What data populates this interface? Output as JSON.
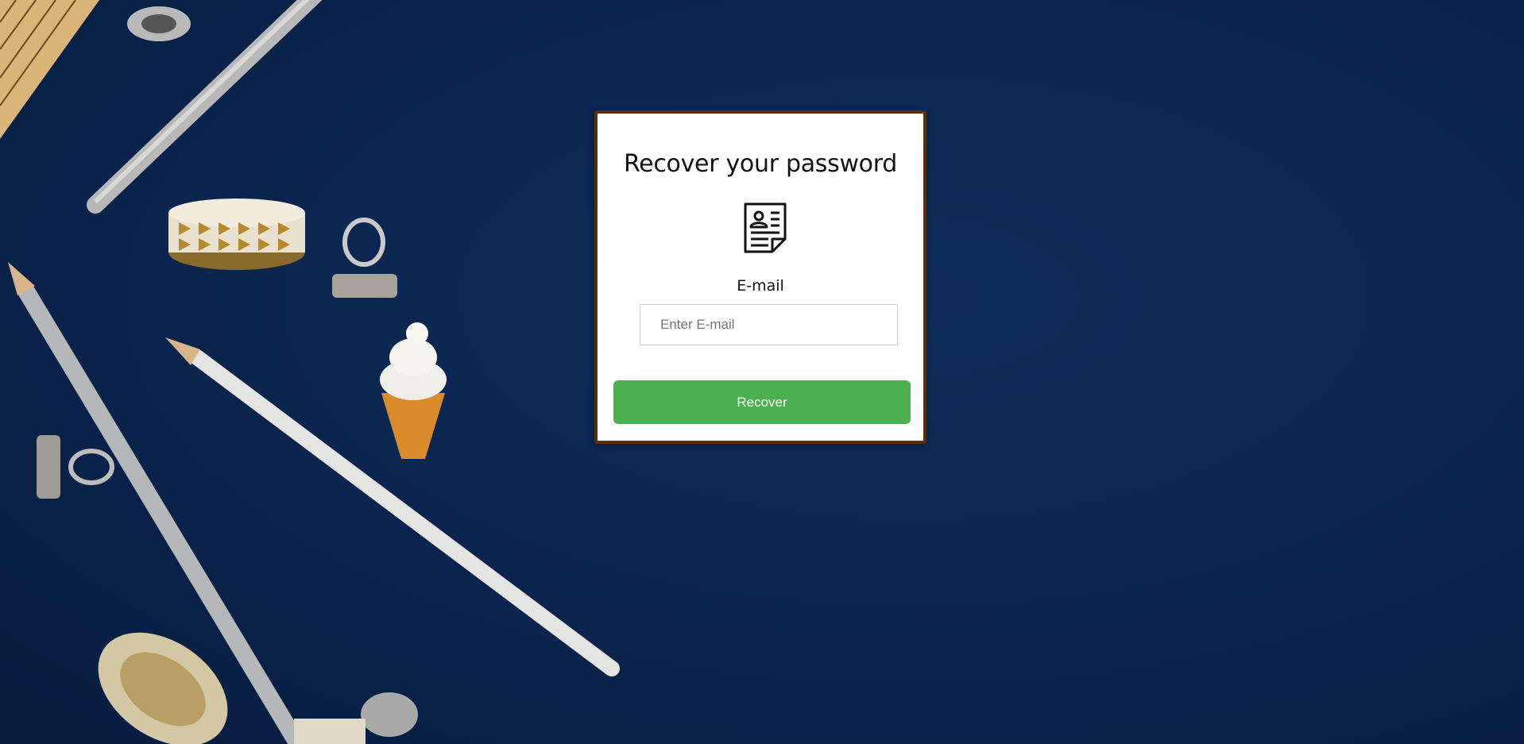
{
  "recover_form": {
    "title": "Recover your password",
    "icon": "profile-document-icon",
    "email_label": "E-mail",
    "email_value": "",
    "email_placeholder": "Enter E-mail",
    "submit_label": "Recover"
  },
  "colors": {
    "background": "#0b2650",
    "card_border": "#5a2f06",
    "button": "#4caf50",
    "button_text": "#ffffff"
  }
}
